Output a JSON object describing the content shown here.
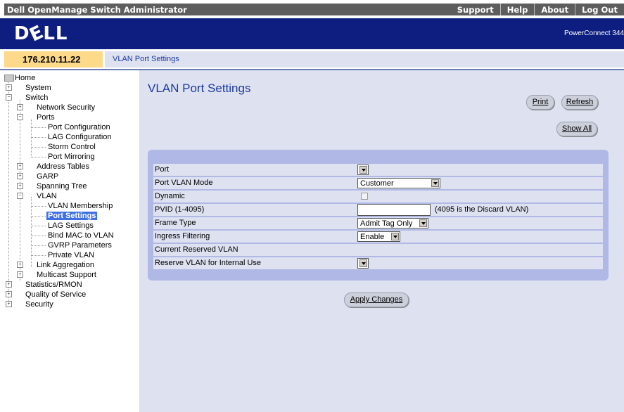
{
  "header": {
    "app_title": "Dell OpenManage Switch Administrator",
    "links": [
      "Support",
      "Help",
      "About",
      "Log Out"
    ]
  },
  "banner": {
    "logo": "DELL",
    "product": "PowerConnect 344"
  },
  "address": {
    "ip": "176.210.11.22",
    "breadcrumb": "VLAN Port Settings"
  },
  "tree": {
    "home": "Home",
    "system": "System",
    "switch": "Switch",
    "network_security": "Network Security",
    "ports": "Ports",
    "port_configuration": "Port Configuration",
    "lag_configuration": "LAG Configuration",
    "storm_control": "Storm Control",
    "port_mirroring": "Port Mirroring",
    "address_tables": "Address Tables",
    "garp": "GARP",
    "spanning_tree": "Spanning Tree",
    "vlan": "VLAN",
    "vlan_membership": "VLAN Membership",
    "port_settings": "Port Settings",
    "lag_settings": "LAG Settings",
    "bind_mac": "Bind MAC to VLAN",
    "gvrp_parameters": "GVRP Parameters",
    "private_vlan": "Private VLAN",
    "link_aggregation": "Link Aggregation",
    "multicast_support": "Multicast Support",
    "statistics": "Statistics/RMON",
    "qos": "Quality of Service",
    "security": "Security"
  },
  "main": {
    "title": "VLAN Port Settings",
    "print_label": "Print",
    "refresh_label": "Refresh",
    "show_all_label": "Show All",
    "apply_label": "Apply Changes"
  },
  "form": {
    "port_label": "Port",
    "port_value": "",
    "mode_label": "Port VLAN Mode",
    "mode_value": "Customer",
    "dynamic_label": "Dynamic",
    "pvid_label": "PVID (1-4095)",
    "pvid_value": "",
    "pvid_note": "(4095 is the Discard VLAN)",
    "frame_label": "Frame Type",
    "frame_value": "Admit Tag Only",
    "ingress_label": "Ingress Filtering",
    "ingress_value": "Enable",
    "reserved_label": "Current Reserved VLAN",
    "reserve_label": "Reserve VLAN for Internal Use",
    "reserve_value": ""
  }
}
